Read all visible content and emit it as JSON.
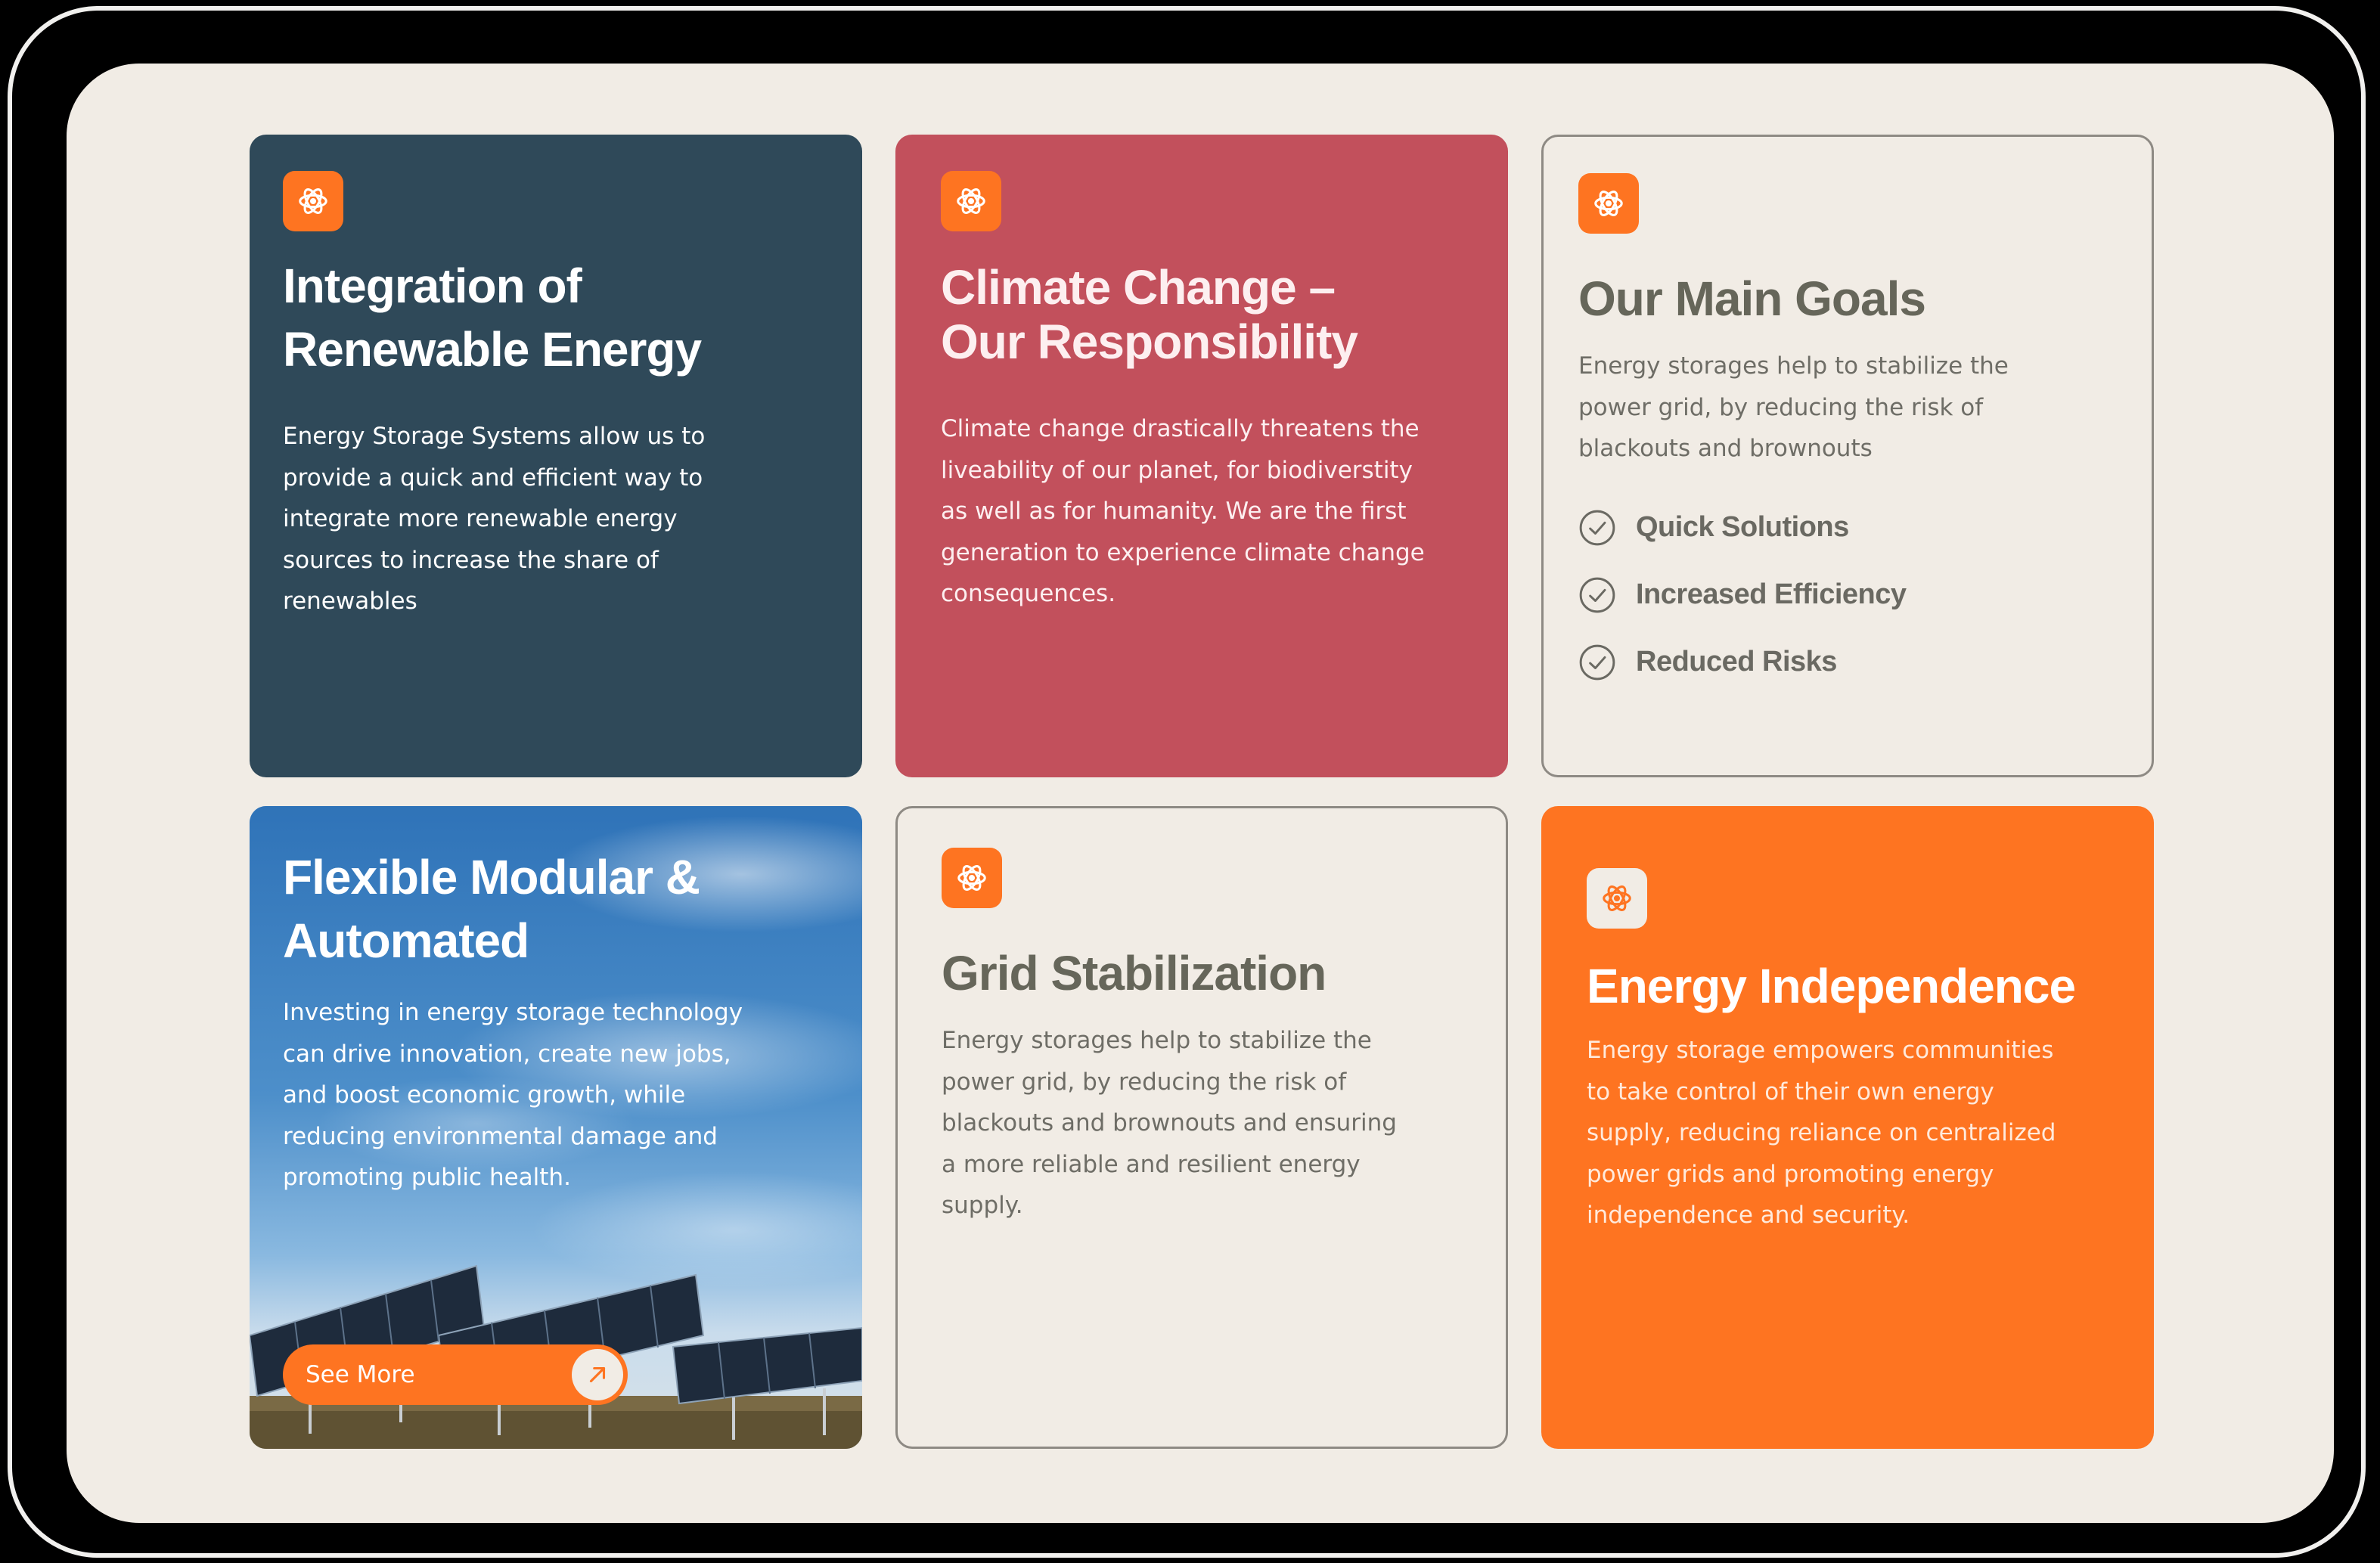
{
  "cards": {
    "renewable": {
      "title_line1": "Integration of",
      "title_line2": "Renewable Energy",
      "body": [
        "Energy Storage Systems allow us to",
        "provide a quick and efficient way to",
        "integrate more renewable energy",
        "sources to increase the share of",
        "renewables"
      ],
      "icon": "atom-icon"
    },
    "climate": {
      "title_line1": "Climate Change –",
      "title_line2": "Our Responsibility",
      "body": [
        "Climate change drastically threatens the",
        "liveability of our planet, for biodiverstity",
        "as well as for humanity. We are the first",
        "generation to experience climate change",
        "consequences."
      ],
      "icon": "atom-icon"
    },
    "goals": {
      "title": "Our Main Goals",
      "body": [
        "Energy storages help to stabilize the",
        "power grid, by reducing the risk of",
        "blackouts and brownouts"
      ],
      "items": [
        "Quick Solutions",
        "Increased Efficiency",
        "Reduced Risks"
      ],
      "item_icon": "check-circle-icon",
      "icon": "atom-icon"
    },
    "modular": {
      "title_line1": "Flexible Modular &",
      "title_line2": "Automated",
      "body": [
        "Investing in energy storage technology",
        "can drive innovation, create new jobs,",
        "and boost economic growth, while",
        "reducing environmental damage and",
        "promoting public health."
      ],
      "button_label": "See More",
      "button_icon": "arrow-up-right-icon",
      "background": "solar-panel-field-photo"
    },
    "grid": {
      "title": "Grid Stabilization",
      "body": [
        "Energy storages help to stabilize the",
        "power grid, by reducing the risk of",
        "blackouts and brownouts and ensuring",
        "a more reliable and resilient energy",
        "supply."
      ],
      "icon": "atom-icon"
    },
    "independence": {
      "title": "Energy Independence",
      "body": [
        "Energy storage empowers communities",
        "to take control of their own energy",
        "supply, reducing reliance on centralized",
        "power grids and promoting energy",
        "independence and security."
      ],
      "icon": "atom-icon"
    }
  },
  "colors": {
    "accent": "#fe7421",
    "dark_card": "#2f4959",
    "red_card": "#c2505c",
    "background": "#f1ece5",
    "muted_text": "#66665a"
  }
}
